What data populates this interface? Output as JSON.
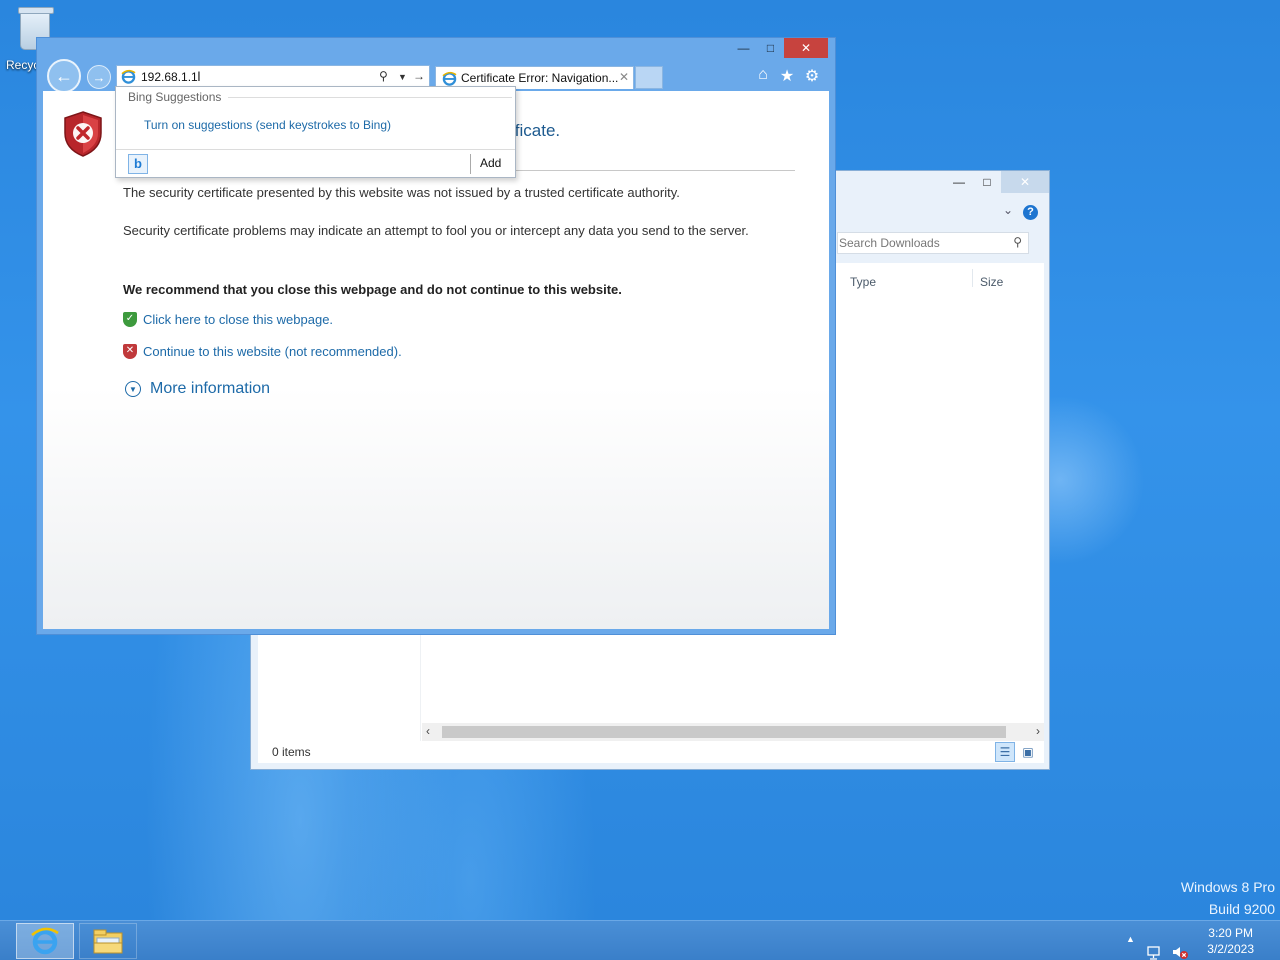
{
  "desktop": {
    "recycle_bin_label": "Recyc",
    "edition_line1": "Windows 8 Pro",
    "edition_line2": "Build 9200"
  },
  "explorer": {
    "minimize_icon": "minimize-icon",
    "maximize_icon": "maximize-icon",
    "close_icon": "close-icon",
    "search_placeholder": "Search Downloads",
    "columns": [
      "Type",
      "Size"
    ],
    "status_items": "0 items"
  },
  "ie": {
    "address_value": "192.68.1.1",
    "tab_title": "Certificate Error: Navigation...",
    "heading_fragment": "ificate.",
    "para1": "The security certificate presented by this website was not issued by a trusted certificate authority.",
    "para2": "Security certificate problems may indicate an attempt to fool you or intercept any data you send to the server.",
    "recommend": "We recommend that you close this webpage and do not continue to this website.",
    "close_link": "Click here to close this webpage.",
    "continue_link": "Continue to this website (not recommended).",
    "more_info": "More information"
  },
  "suggestions": {
    "header": "Bing Suggestions",
    "item": "Turn on suggestions (send keystrokes to Bing)",
    "add_label": "Add"
  },
  "taskbar": {
    "time": "3:20 PM",
    "date": "3/2/2023"
  },
  "colors": {
    "accent": "#1d6aa8",
    "close_red": "#c7433e",
    "desktop_blue": "#2f8ce3"
  }
}
